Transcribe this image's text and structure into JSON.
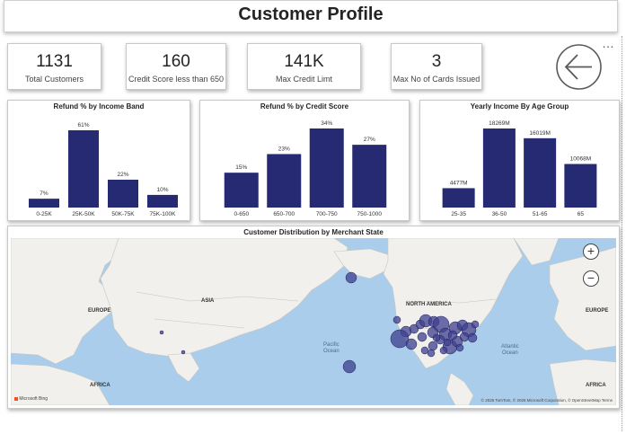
{
  "header": {
    "title": "Customer Profile"
  },
  "kpis": [
    {
      "value": "1131",
      "label": "Total Customers"
    },
    {
      "value": "160",
      "label": "Credit Score less than 650"
    },
    {
      "value": "141K",
      "label": "Max Credit Limt"
    },
    {
      "value": "3",
      "label": "Max No of Cards Issued"
    }
  ],
  "more_options": "…",
  "chart_data": [
    {
      "type": "bar",
      "title": "Refund % by Income Band",
      "categories": [
        "0-25K",
        "25K-50K",
        "50K-75K",
        "75K-100K"
      ],
      "values": [
        7,
        61,
        22,
        10
      ],
      "labels": [
        "7%",
        "61%",
        "22%",
        "10%"
      ],
      "ylim": [
        0,
        61
      ],
      "color": "#252a73"
    },
    {
      "type": "bar",
      "title": "Refund % by Credit Score",
      "categories": [
        "0-650",
        "650-700",
        "700-750",
        "750-1000"
      ],
      "values": [
        15,
        23,
        34,
        27
      ],
      "labels": [
        "15%",
        "23%",
        "34%",
        "27%"
      ],
      "ylim": [
        0,
        34
      ],
      "color": "#252a73"
    },
    {
      "type": "bar",
      "title": "Yearly Income By Age Group",
      "categories": [
        "25-35",
        "36-50",
        "51-65",
        "65"
      ],
      "values": [
        4477,
        18269,
        16019,
        10068
      ],
      "labels": [
        "4477M",
        "18269M",
        "16019M",
        "10068M"
      ],
      "ylim": [
        0,
        18269
      ],
      "color": "#252a73"
    }
  ],
  "map": {
    "title": "Customer Distribution by Merchant State",
    "zoom_in": "+",
    "zoom_out": "−",
    "labels": {
      "asia": "ASIA",
      "europe_left": "EUROPE",
      "europe_right": "EUROPE",
      "north_america": "NORTH AMERICA",
      "africa_left": "AFRICA",
      "africa_right": "AFRICA",
      "pacific": "Pacific\nOcean",
      "atlantic": "Atlantic\nOcean"
    },
    "brand": "Microsoft Bing",
    "attribution": "© 2025 TomTom, © 2025 Microsoft Corporation, © OpenStreetMap  Terms",
    "bubble_color": "#3d3f8f"
  }
}
